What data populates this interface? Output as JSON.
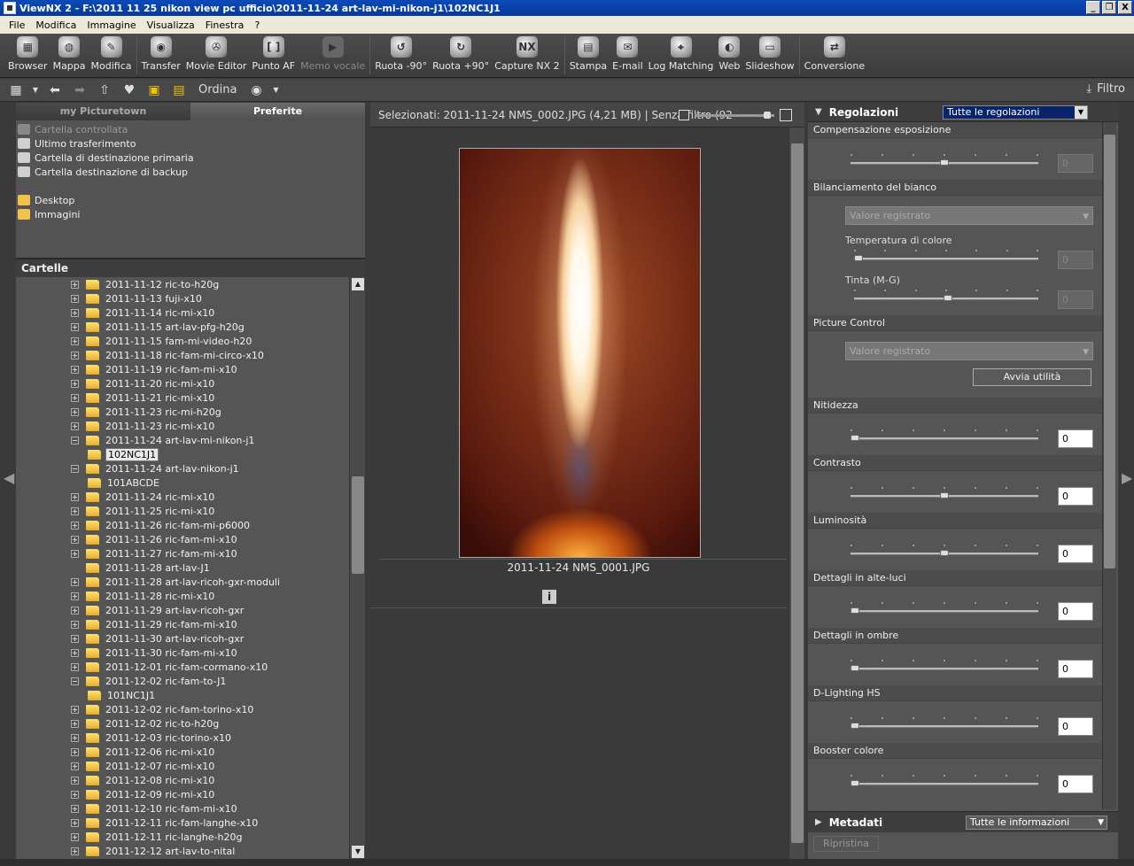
{
  "window": {
    "title": "ViewNX 2 - F:\\2011 11 25 nikon view pc ufficio\\2011-11-24 art-lav-mi-nikon-j1\\102NC1J1",
    "controls": [
      "_",
      "❐",
      "X"
    ]
  },
  "menu": [
    "File",
    "Modifica",
    "Immagine",
    "Visualizza",
    "Finestra",
    "?"
  ],
  "toolbar": [
    {
      "label": "Browser",
      "icon": "browser-icon",
      "glyph": "▦",
      "enabled": true
    },
    {
      "label": "Mappa",
      "icon": "globe-icon",
      "glyph": "◍",
      "enabled": true
    },
    {
      "label": "Modifica",
      "icon": "pencil-icon",
      "glyph": "✎",
      "enabled": true
    },
    {
      "sep": true
    },
    {
      "label": "Transfer",
      "icon": "camera-icon",
      "glyph": "◉",
      "enabled": true
    },
    {
      "label": "Movie Editor",
      "icon": "film-reel-icon",
      "glyph": "✇",
      "enabled": true
    },
    {
      "label": "Punto AF",
      "icon": "af-bracket-icon",
      "glyph": "[ ]",
      "enabled": true
    },
    {
      "label": "Memo vocale",
      "icon": "voice-memo-icon",
      "glyph": "▶",
      "enabled": false
    },
    {
      "sep": true
    },
    {
      "label": "Ruota -90°",
      "icon": "rotate-left-icon",
      "glyph": "↺",
      "enabled": true
    },
    {
      "label": "Ruota +90°",
      "icon": "rotate-right-icon",
      "glyph": "↻",
      "enabled": true
    },
    {
      "label": "Capture NX 2",
      "icon": "capture-nx-icon",
      "glyph": "NX",
      "enabled": true
    },
    {
      "sep": true
    },
    {
      "label": "Stampa",
      "icon": "printer-icon",
      "glyph": "▤",
      "enabled": true
    },
    {
      "label": "E-mail",
      "icon": "envelope-icon",
      "glyph": "✉",
      "enabled": true
    },
    {
      "label": "Log Matching",
      "icon": "log-matching-icon",
      "glyph": "⌖",
      "enabled": true
    },
    {
      "label": "Web",
      "icon": "web-icon",
      "glyph": "◐",
      "enabled": true
    },
    {
      "label": "Slideshow",
      "icon": "slideshow-icon",
      "glyph": "▭",
      "enabled": true
    },
    {
      "sep": true
    },
    {
      "label": "Conversione",
      "icon": "convert-icon",
      "glyph": "⇄",
      "enabled": true
    }
  ],
  "toolbar2": {
    "ordina_label": "Ordina",
    "filtro_label": "Filtro"
  },
  "left": {
    "tabs": [
      "my Picturetown",
      "Preferite"
    ],
    "shortcuts": [
      {
        "label": "Cartella controllata",
        "dim": true,
        "icon": "nx2-icon"
      },
      {
        "label": "Ultimo trasferimento",
        "dim": false,
        "icon": "camera-transfer-icon"
      },
      {
        "label": "Cartella di destinazione primaria",
        "dim": false,
        "icon": "camera-transfer-icon"
      },
      {
        "label": "Cartella destinazione di backup",
        "dim": false,
        "icon": "camera-transfer-icon"
      }
    ],
    "places": [
      {
        "label": "Desktop",
        "icon": "desktop-folder-icon"
      },
      {
        "label": "Immagini",
        "icon": "pictures-folder-icon"
      }
    ],
    "cartelle_label": "Cartelle",
    "tree": [
      {
        "label": "2011-11-12 ric-to-h20g",
        "level": 0,
        "exp": "+"
      },
      {
        "label": "2011-11-13 fuji-x10",
        "level": 0,
        "exp": "+"
      },
      {
        "label": "2011-11-14 ric-mi-x10",
        "level": 0,
        "exp": "+"
      },
      {
        "label": "2011-11-15 art-lav-pfg-h20g",
        "level": 0,
        "exp": "+"
      },
      {
        "label": "2011-11-15 fam-mi-video-h20",
        "level": 0,
        "exp": "+"
      },
      {
        "label": "2011-11-18 ric-fam-mi-circo-x10",
        "level": 0,
        "exp": "+"
      },
      {
        "label": "2011-11-19 ric-fam-mi-x10",
        "level": 0,
        "exp": "+"
      },
      {
        "label": "2011-11-20 ric-mi-x10",
        "level": 0,
        "exp": "+"
      },
      {
        "label": "2011-11-21 ric-mi-x10",
        "level": 0,
        "exp": "+"
      },
      {
        "label": "2011-11-23 ric-mi-h20g",
        "level": 0,
        "exp": "+"
      },
      {
        "label": "2011-11-23 ric-mi-x10",
        "level": 0,
        "exp": "+"
      },
      {
        "label": "2011-11-24 art-lav-mi-nikon-j1",
        "level": 0,
        "exp": "−"
      },
      {
        "label": "102NC1J1",
        "level": 1,
        "exp": "",
        "selected": true
      },
      {
        "label": "2011-11-24 art-lav-nikon-j1",
        "level": 0,
        "exp": "−"
      },
      {
        "label": "101ABCDE",
        "level": 1,
        "exp": ""
      },
      {
        "label": "2011-11-24 ric-mi-x10",
        "level": 0,
        "exp": "+"
      },
      {
        "label": "2011-11-25 ric-mi-x10",
        "level": 0,
        "exp": "+"
      },
      {
        "label": "2011-11-26 ric-fam-mi-p6000",
        "level": 0,
        "exp": "+"
      },
      {
        "label": "2011-11-26 ric-fam-mi-x10",
        "level": 0,
        "exp": "+"
      },
      {
        "label": "2011-11-27 ric-fam-mi-x10",
        "level": 0,
        "exp": "+"
      },
      {
        "label": "2011-11-28 art-lav-J1",
        "level": 0,
        "exp": ""
      },
      {
        "label": "2011-11-28 art-lav-ricoh-gxr-moduli",
        "level": 0,
        "exp": "+"
      },
      {
        "label": "2011-11-28 ric-mi-x10",
        "level": 0,
        "exp": "+"
      },
      {
        "label": "2011-11-29 art-lav-ricoh-gxr",
        "level": 0,
        "exp": "+"
      },
      {
        "label": "2011-11-29 ric-fam-mi-x10",
        "level": 0,
        "exp": "+"
      },
      {
        "label": "2011-11-30 art-lav-ricoh-gxr",
        "level": 0,
        "exp": "+"
      },
      {
        "label": "2011-11-30 ric-fam-mi-x10",
        "level": 0,
        "exp": "+"
      },
      {
        "label": "2011-12-01 ric-fam-cormano-x10",
        "level": 0,
        "exp": "+"
      },
      {
        "label": "2011-12-02 ric-fam-to-J1",
        "level": 0,
        "exp": "−"
      },
      {
        "label": "101NC1J1",
        "level": 1,
        "exp": ""
      },
      {
        "label": "2011-12-02 ric-fam-torino-x10",
        "level": 0,
        "exp": "+"
      },
      {
        "label": "2011-12-02 ric-to-h20g",
        "level": 0,
        "exp": "+"
      },
      {
        "label": "2011-12-03 ric-torino-x10",
        "level": 0,
        "exp": "+"
      },
      {
        "label": "2011-12-06 ric-mi-x10",
        "level": 0,
        "exp": "+"
      },
      {
        "label": "2011-12-07 ric-mi-x10",
        "level": 0,
        "exp": "+"
      },
      {
        "label": "2011-12-08 ric-mi-x10",
        "level": 0,
        "exp": "+"
      },
      {
        "label": "2011-12-09 ric-mi-x10",
        "level": 0,
        "exp": "+"
      },
      {
        "label": "2011-12-10 ric-fam-mi-x10",
        "level": 0,
        "exp": "+"
      },
      {
        "label": "2011-12-11 ric-fam-langhe-x10",
        "level": 0,
        "exp": "+"
      },
      {
        "label": "2011-12-11 ric-langhe-h20g",
        "level": 0,
        "exp": "+"
      },
      {
        "label": "2011-12-12 art-lav-to-nital",
        "level": 0,
        "exp": "+"
      }
    ]
  },
  "center": {
    "status": "Selezionati: 2011-11-24 NMS_0002.JPG (4,21 MB) | Senza filtro  (92",
    "caption": "2011-11-24 NMS_0001.JPG",
    "info_label": "i"
  },
  "right": {
    "title": "Regolazioni",
    "dropdown": "Tutte le regolazioni",
    "sections": [
      {
        "title": "Compensazione esposizione",
        "type": "slider",
        "value": "0",
        "disabled": true,
        "knob": 0.5
      },
      {
        "title": "Bilanciamento del bianco",
        "type": "wb",
        "select": "Valore registrato",
        "subs": [
          {
            "label": "Temperatura di colore",
            "value": "0",
            "knob": 0.0
          },
          {
            "label": "Tinta (M-G)",
            "value": "0",
            "knob": 0.5
          }
        ]
      },
      {
        "title": "Picture Control",
        "type": "pc",
        "select": "Valore registrato",
        "button": "Avvia utilità"
      },
      {
        "title": "Nitidezza",
        "type": "slider",
        "value": "0",
        "disabled": false,
        "knob": 0.0
      },
      {
        "title": "Contrasto",
        "type": "slider",
        "value": "0",
        "disabled": false,
        "knob": 0.5
      },
      {
        "title": "Luminosità",
        "type": "slider",
        "value": "0",
        "disabled": false,
        "knob": 0.5
      },
      {
        "title": "Dettagli in alte-luci",
        "type": "slider",
        "value": "0",
        "disabled": false,
        "knob": 0.0
      },
      {
        "title": "Dettagli in ombre",
        "type": "slider",
        "value": "0",
        "disabled": false,
        "knob": 0.0
      },
      {
        "title": "D-Lighting HS",
        "type": "slider",
        "value": "0",
        "disabled": false,
        "knob": 0.0
      },
      {
        "title": "Booster colore",
        "type": "slider",
        "value": "0",
        "disabled": false,
        "knob": 0.0
      }
    ],
    "meta_title": "Metadati",
    "meta_dropdown": "Tutte le informazioni",
    "ripristina": "Ripristina"
  }
}
